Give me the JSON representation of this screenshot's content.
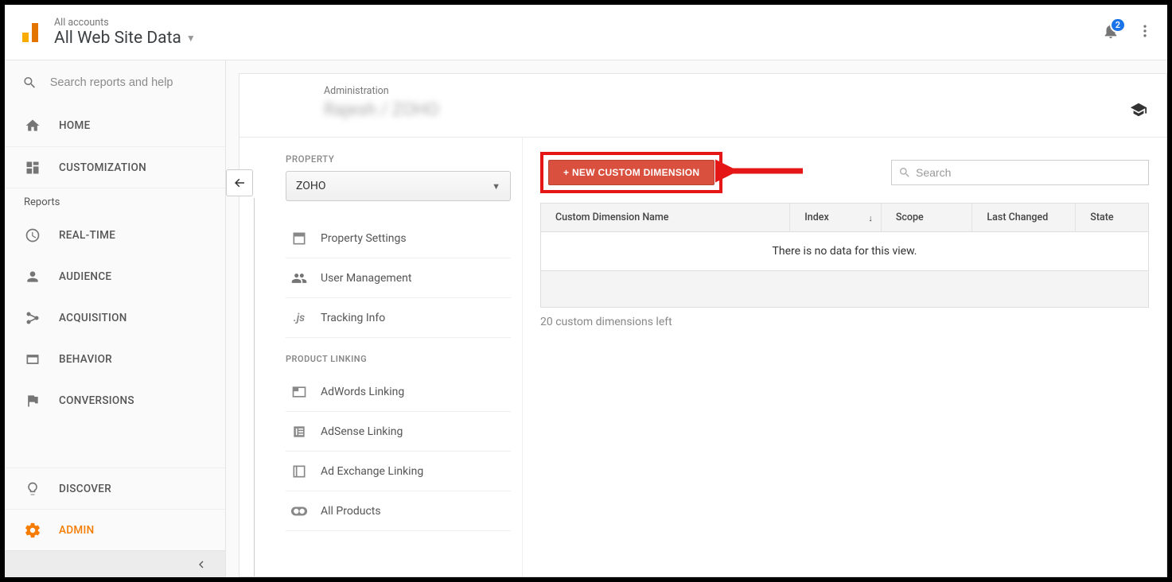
{
  "header": {
    "accounts_label": "All accounts",
    "view_title": "All Web Site Data",
    "notification_count": "2"
  },
  "leftnav": {
    "search_placeholder": "Search reports and help",
    "home": "HOME",
    "customization": "CUSTOMIZATION",
    "reports_label": "Reports",
    "realtime": "REAL-TIME",
    "audience": "AUDIENCE",
    "acquisition": "ACQUISITION",
    "behavior": "BEHAVIOR",
    "conversions": "CONVERSIONS",
    "discover": "DISCOVER",
    "admin": "ADMIN"
  },
  "admin_panel": {
    "crumb": "Administration",
    "breadcrumb_blurred": "Rajesh / ZOHO"
  },
  "property": {
    "label": "PROPERTY",
    "selected": "ZOHO",
    "items": {
      "settings": "Property Settings",
      "user_mgmt": "User Management",
      "tracking": "Tracking Info"
    },
    "linking_header": "PRODUCT LINKING",
    "linking": {
      "adwords": "AdWords Linking",
      "adsense": "AdSense Linking",
      "adexchange": "Ad Exchange Linking",
      "all_products": "All Products"
    }
  },
  "cd_table": {
    "new_button": "+ NEW CUSTOM DIMENSION",
    "search_placeholder": "Search",
    "col_name": "Custom Dimension Name",
    "col_index": "Index",
    "col_scope": "Scope",
    "col_last_changed": "Last Changed",
    "col_state": "State",
    "empty_msg": "There is no data for this view.",
    "remaining": "20 custom dimensions left"
  }
}
